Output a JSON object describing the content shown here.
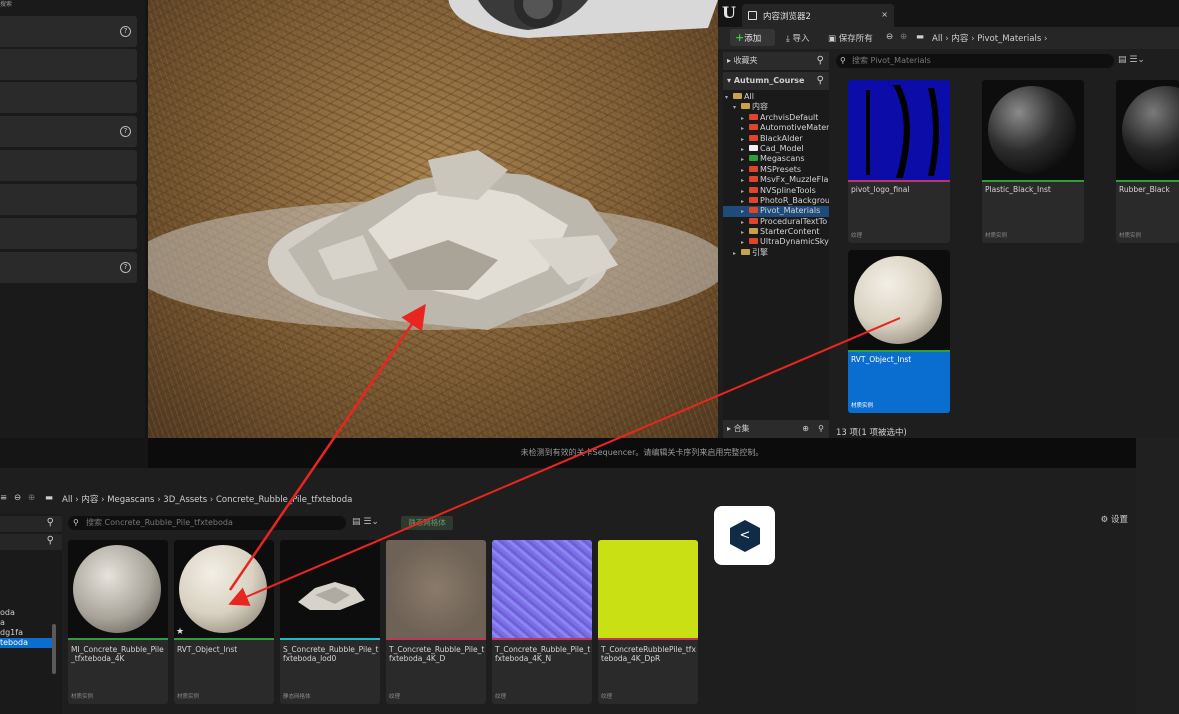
{
  "left_panel": {
    "header": "搜索"
  },
  "viewport": {
    "status_message": "未检测到有效的关卡Sequencer。请编辑关卡序列来启用完整控制。"
  },
  "content_browser_2": {
    "tab_title": "内容浏览器2",
    "close_glyph": "×",
    "toolbar": {
      "add_label": "添加",
      "import_label": "导入",
      "save_all_label": "保存所有",
      "breadcrumb": [
        "All",
        "内容",
        "Pivot_Materials"
      ]
    },
    "sources": {
      "favorites_label": "收藏夹",
      "project_label": "Autumn_Course",
      "collections_label": "合集",
      "tree": [
        {
          "label": "All",
          "depth": 0,
          "color": "#c8a24a",
          "expanded": true
        },
        {
          "label": "内容",
          "depth": 1,
          "color": "#c8a24a",
          "expanded": true
        },
        {
          "label": "ArchvisDefault",
          "depth": 2,
          "color": "#e0452c"
        },
        {
          "label": "AutomotiveMater",
          "depth": 2,
          "color": "#e0452c"
        },
        {
          "label": "BlackAlder",
          "depth": 2,
          "color": "#e0452c"
        },
        {
          "label": "Cad_Model",
          "depth": 2,
          "color": "#f2f2f2"
        },
        {
          "label": "Megascans",
          "depth": 2,
          "color": "#2e9e3a"
        },
        {
          "label": "MSPresets",
          "depth": 2,
          "color": "#e0452c"
        },
        {
          "label": "MsvFx_MuzzleFla",
          "depth": 2,
          "color": "#e0452c"
        },
        {
          "label": "NVSplineTools",
          "depth": 2,
          "color": "#e0452c"
        },
        {
          "label": "PhotoR_Backgrou",
          "depth": 2,
          "color": "#e0452c"
        },
        {
          "label": "Pivot_Materials",
          "depth": 2,
          "color": "#e0452c",
          "selected": true
        },
        {
          "label": "ProceduralTextTo",
          "depth": 2,
          "color": "#e0452c"
        },
        {
          "label": "StarterContent",
          "depth": 2,
          "color": "#c8a24a"
        },
        {
          "label": "UltraDynamicSky",
          "depth": 2,
          "color": "#e0452c"
        },
        {
          "label": "引擎",
          "depth": 1,
          "color": "#c8a24a"
        }
      ]
    },
    "search_placeholder": "搜索 Pivot_Materials",
    "assets": [
      {
        "name": "pivot_logo_final",
        "type": "纹理",
        "line_color": "#c0365a"
      },
      {
        "name": "Plastic_Black_Inst",
        "type": "材质实例",
        "line_color": "#2e9e3a"
      },
      {
        "name": "Rubber_Black",
        "type": "材质实例",
        "line_color": "#2e9e3a"
      },
      {
        "name": "RVT_Object_Inst",
        "type": "材质实例",
        "line_color": "#2e9e3a",
        "selected": true
      }
    ],
    "item_count": "13 项(1 项被选中)"
  },
  "content_browser_1": {
    "breadcrumb": [
      "All",
      "内容",
      "Megascans",
      "3D_Assets",
      "Concrete_Rubble_Pile_tfxteboda"
    ],
    "settings_label": "设置",
    "search_placeholder": "搜索 Concrete_Rubble_Pile_tfxteboda",
    "static_mesh_chip": "静态网格体",
    "tree_fragments": [
      "oda",
      "a",
      "dg1fa",
      "teboda"
    ],
    "assets": [
      {
        "name": "MI_Concrete_Rubble_Pile_tfxteboda_4K",
        "type": "材质实例",
        "line_color": "#2e9e3a"
      },
      {
        "name": "RVT_Object_Inst",
        "type": "材质实例",
        "line_color": "#2e9e3a"
      },
      {
        "name": "S_Concrete_Rubble_Pile_tfxteboda_lod0",
        "type": "静态网格体",
        "line_color": "#27b5c9"
      },
      {
        "name": "T_Concrete_Rubble_Pile_tfxteboda_4K_D",
        "type": "纹理",
        "line_color": "#c0365a"
      },
      {
        "name": "T_Concrete_Rubble_Pile_tfxteboda_4K_N",
        "type": "纹理",
        "line_color": "#c0365a"
      },
      {
        "name": "T_ConcreteRubblePile_tfxteboda_4K_DpR",
        "type": "纹理",
        "line_color": "#c0365a"
      }
    ]
  },
  "colors": {
    "accent": "#0a6ed1",
    "annotation_arrow": "#e8261f"
  }
}
